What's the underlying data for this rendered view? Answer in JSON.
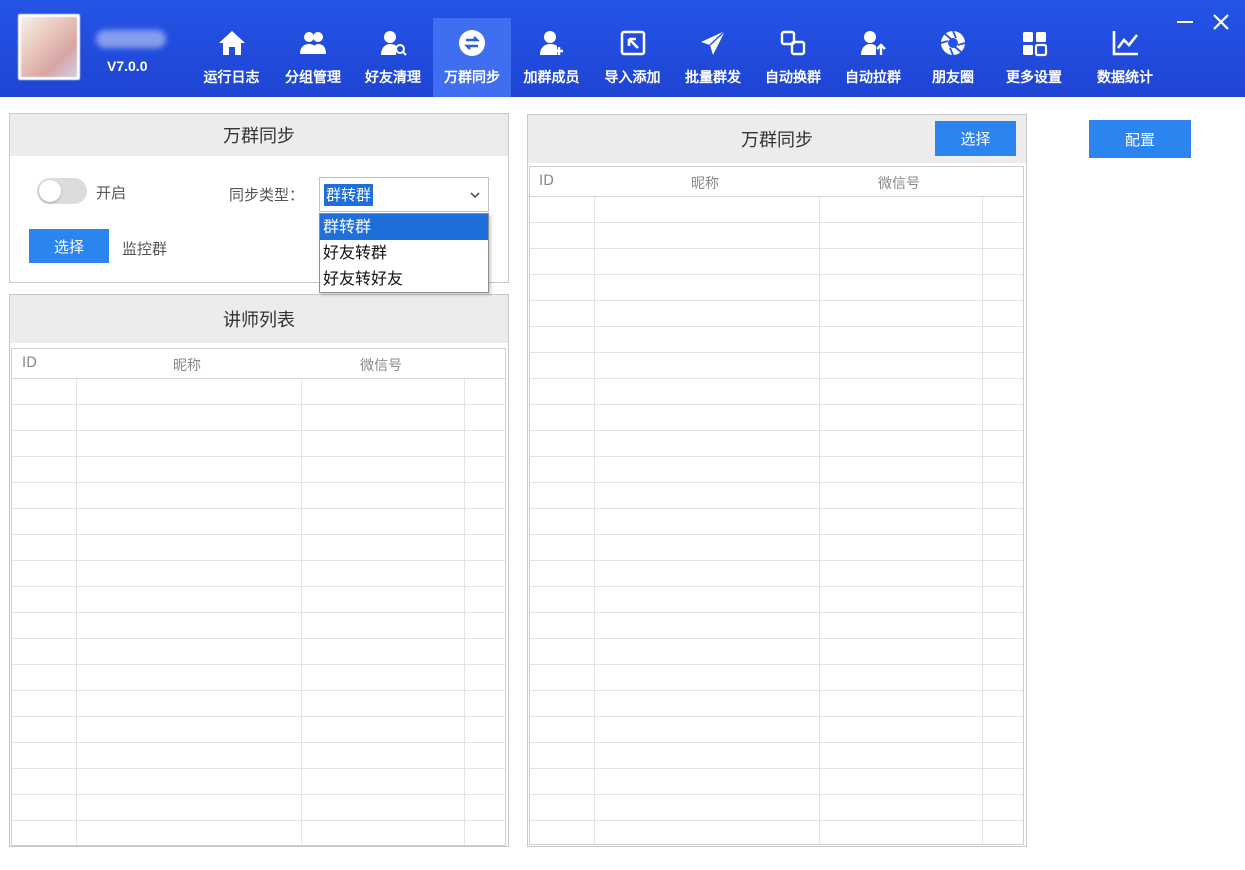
{
  "header": {
    "version": "V7.0.0",
    "nav": [
      {
        "label": "运行日志",
        "icon": "home-icon"
      },
      {
        "label": "分组管理",
        "icon": "users-icon"
      },
      {
        "label": "好友清理",
        "icon": "user-search-icon"
      },
      {
        "label": "万群同步",
        "icon": "sync-icon"
      },
      {
        "label": "加群成员",
        "icon": "user-add-icon"
      },
      {
        "label": "导入添加",
        "icon": "import-icon"
      },
      {
        "label": "批量群发",
        "icon": "send-icon"
      },
      {
        "label": "自动换群",
        "icon": "swap-icon"
      },
      {
        "label": "自动拉群",
        "icon": "user-up-icon"
      },
      {
        "label": "朋友圈",
        "icon": "aperture-icon"
      },
      {
        "label": "更多设置",
        "icon": "grid-icon"
      },
      {
        "label": "数据统计",
        "icon": "chart-icon"
      }
    ],
    "active_index": 3
  },
  "sync_panel": {
    "title": "万群同步",
    "toggle_label": "开启",
    "toggle_on": false,
    "type_label": "同步类型：",
    "type_value": "群转群",
    "type_options": [
      "群转群",
      "好友转群",
      "好友转好友"
    ],
    "select_button": "选择",
    "monitor_label": "监控群"
  },
  "teacher_panel": {
    "title": "讲师列表",
    "columns": [
      "ID",
      "昵称",
      "微信号"
    ]
  },
  "right_panel": {
    "title": "万群同步",
    "select_button": "选择",
    "columns": [
      "ID",
      "昵称",
      "微信号"
    ]
  },
  "config_button": "配置",
  "colors": {
    "header_bg": "#2454e6",
    "active_tab": "#3f6ff0",
    "button_blue": "#2b84f0",
    "selection_blue": "#1e6fd9"
  }
}
